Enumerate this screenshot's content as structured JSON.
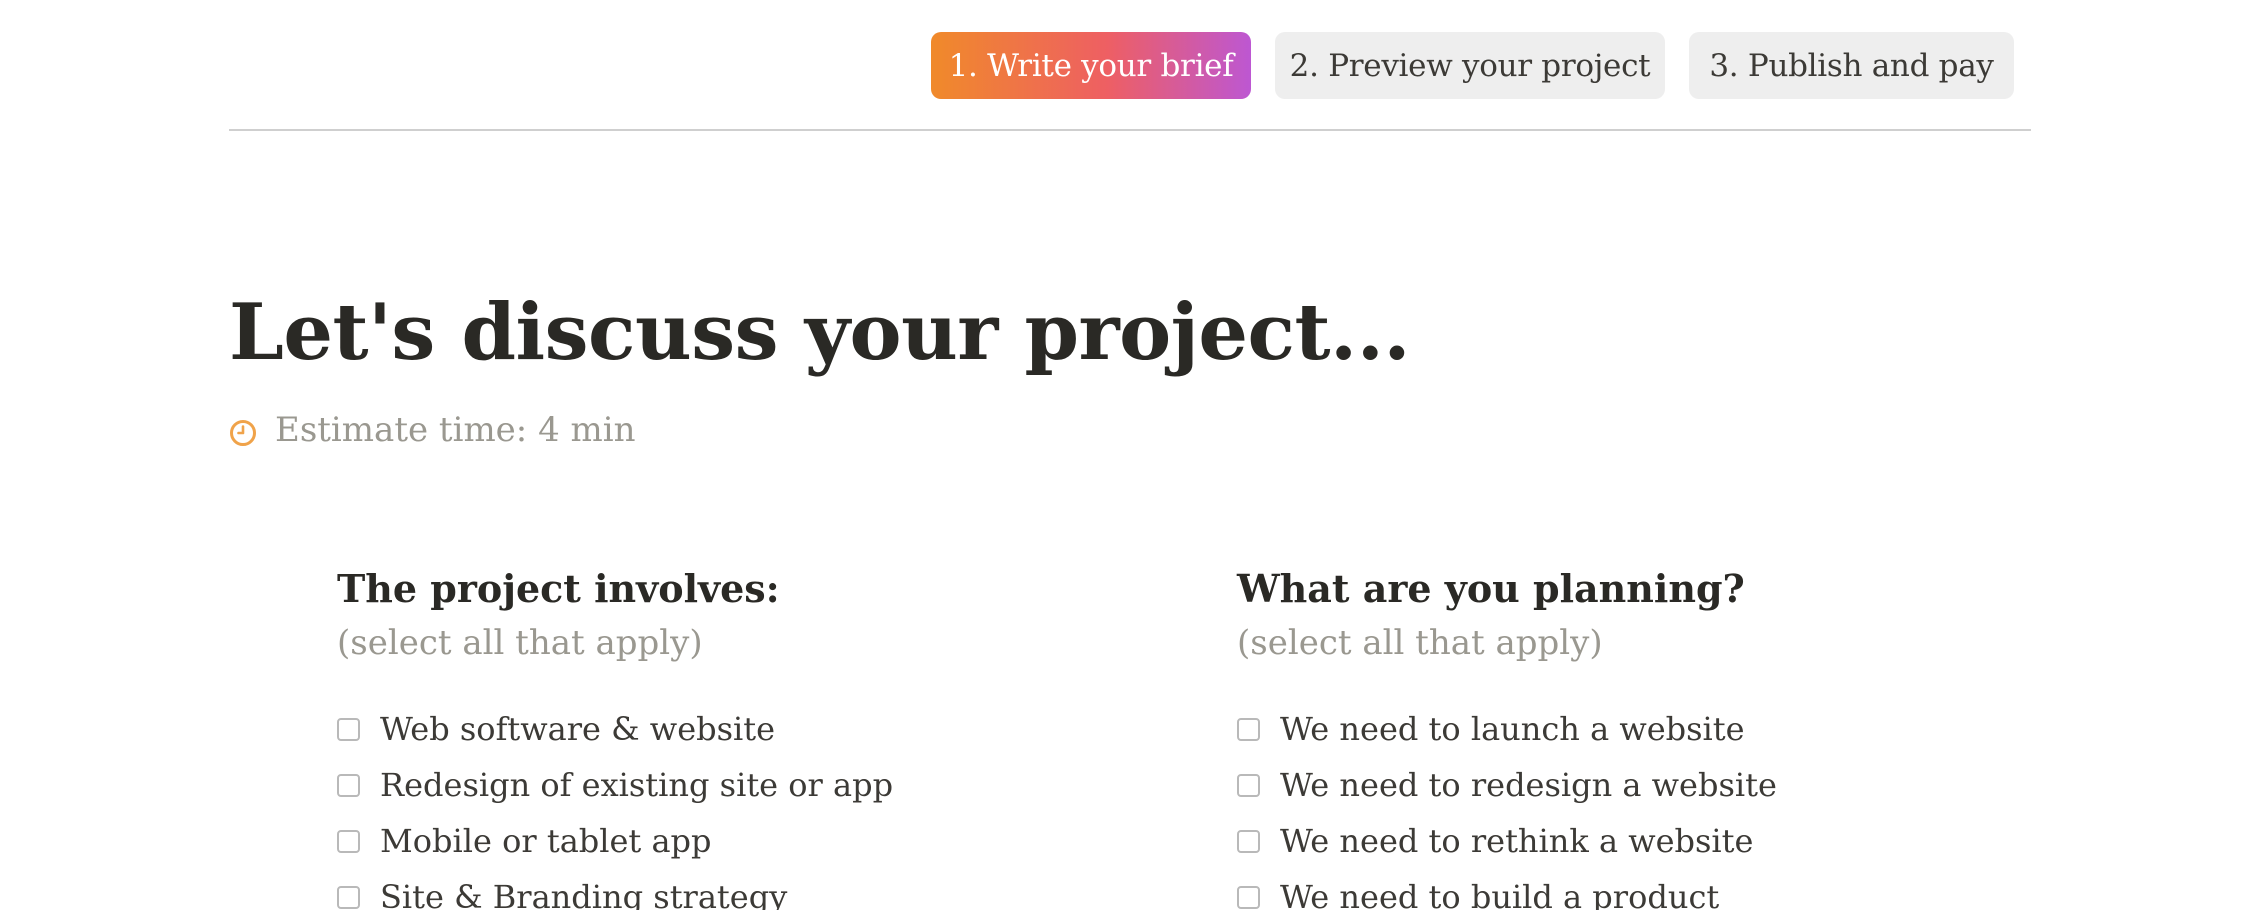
{
  "steps": [
    {
      "label": "1. Write your brief",
      "active": true
    },
    {
      "label": "2. Preview your project",
      "active": false
    },
    {
      "label": "3. Publish and pay",
      "active": false
    }
  ],
  "page_title": "Let's discuss your project...",
  "estimate": {
    "icon": "clock-icon",
    "icon_color": "#f0a34a",
    "text": "Estimate time: 4 min"
  },
  "columns": {
    "involves": {
      "heading": "The project involves:",
      "subheading": "(select all that apply)",
      "options": [
        "Web software & website",
        "Redesign of existing site or app",
        "Mobile or tablet app",
        "Site & Branding strategy"
      ]
    },
    "planning": {
      "heading": "What are you planning?",
      "subheading": "(select all that apply)",
      "options": [
        "We need to launch a website",
        "We need to redesign a website",
        "We need to rethink a website",
        "We need to build a product"
      ]
    }
  },
  "colors": {
    "step_active_gradient": [
      "#f08a2a",
      "#ee5f63",
      "#bd57d2"
    ],
    "step_inactive_bg": "#eeeeee",
    "muted_text": "#9a9890",
    "heading_text": "#2a2925"
  }
}
